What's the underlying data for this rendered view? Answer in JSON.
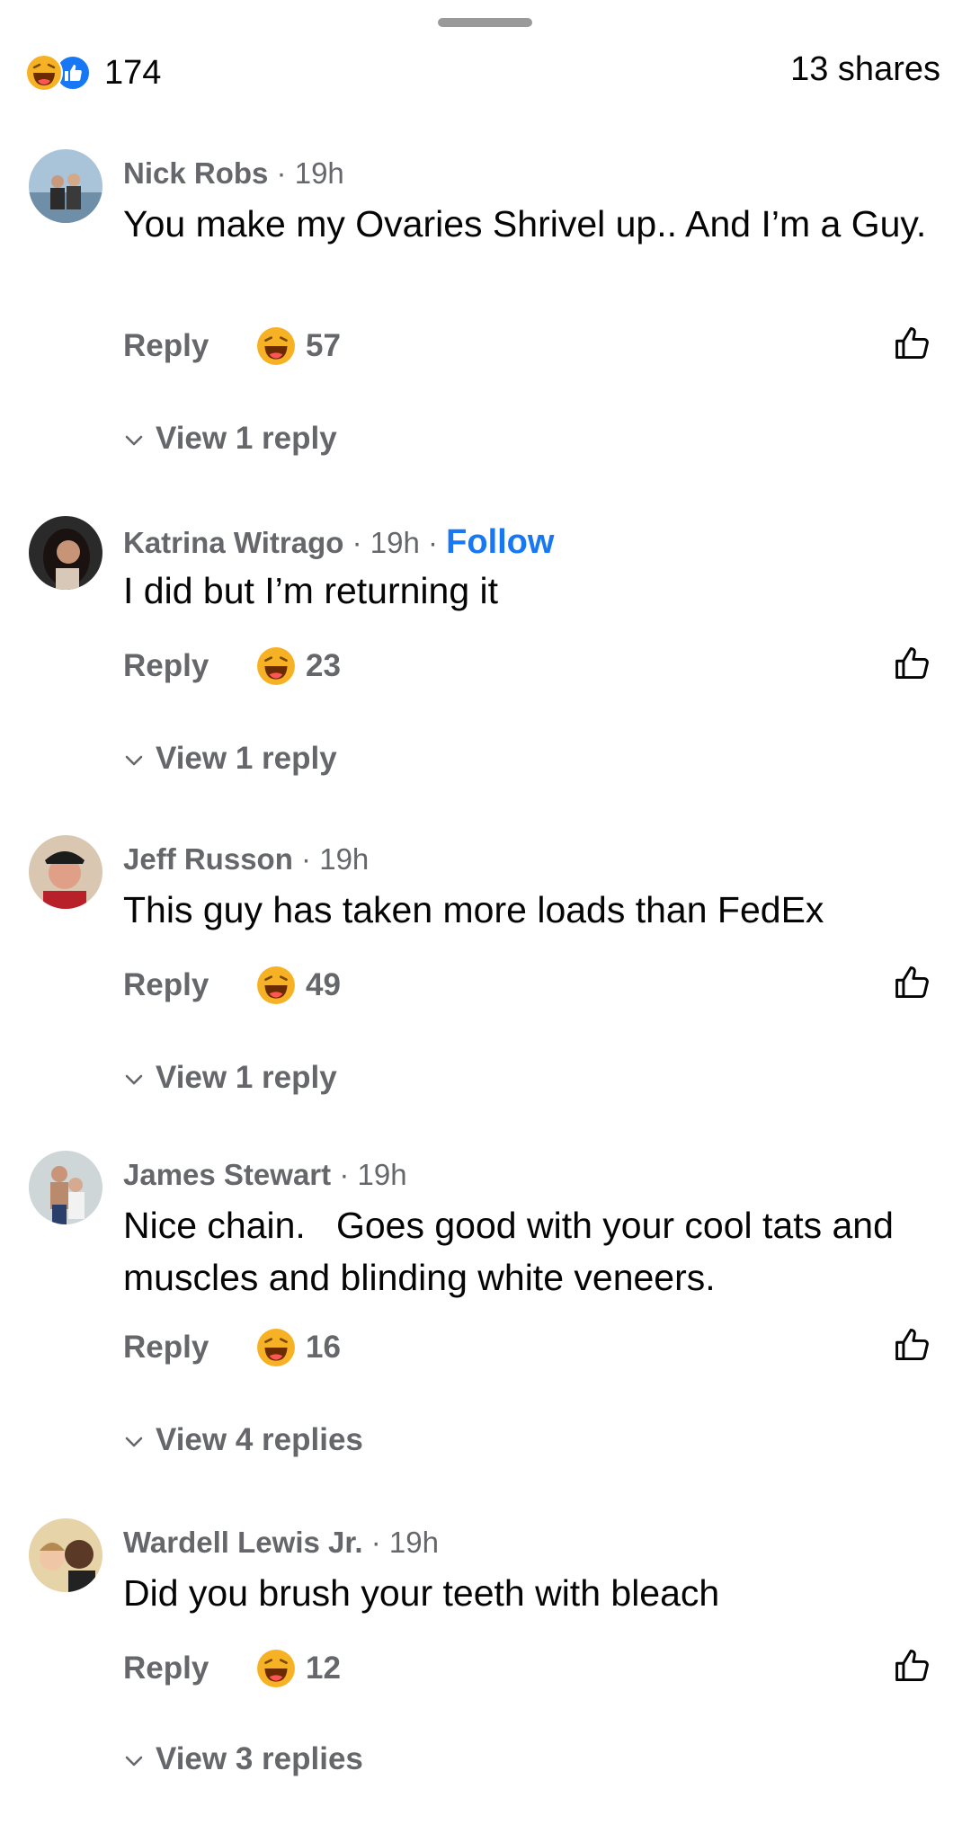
{
  "header": {
    "reaction_count": "174",
    "shares": "13 shares",
    "reaction_icons": [
      "haha-icon",
      "like-icon"
    ]
  },
  "comments": [
    {
      "author": "Nick Robs",
      "time": "19h",
      "text": "You make my Ovaries Shrivel up.. And I’m a Guy.",
      "reply_label": "Reply",
      "reaction_count": "57",
      "view_replies": "View 1 reply"
    },
    {
      "author": "Katrina Witrago",
      "time": "19h",
      "follow_label": "Follow",
      "text": "I did but I’m returning it",
      "reply_label": "Reply",
      "reaction_count": "23",
      "view_replies": "View 1 reply"
    },
    {
      "author": "Jeff Russon",
      "time": "19h",
      "text": "This guy has taken more loads than FedEx",
      "reply_label": "Reply",
      "reaction_count": "49",
      "view_replies": "View 1 reply"
    },
    {
      "author": "James Stewart",
      "time": "19h",
      "text": "Nice chain.   Goes good with your cool tats and muscles and blinding white veneers.",
      "reply_label": "Reply",
      "reaction_count": "16",
      "view_replies": "View 4 replies"
    },
    {
      "author": "Wardell Lewis Jr.",
      "time": "19h",
      "text": "Did you brush your teeth with bleach",
      "reply_label": "Reply",
      "reaction_count": "12",
      "view_replies": "View 3 replies"
    }
  ],
  "colors": {
    "accent": "#1877f2",
    "secondary_text": "#65676b",
    "primary_text": "#050505",
    "haha_yellow": "#f7b125"
  }
}
